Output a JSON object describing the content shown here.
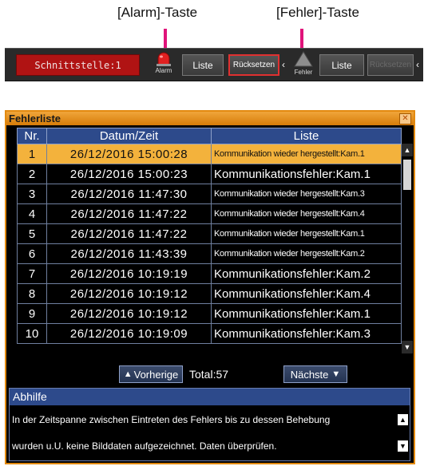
{
  "callouts": {
    "alarm_key": "[Alarm]-Taste",
    "error_key": "[Fehler]-Taste"
  },
  "toolbar": {
    "status_text": "Schnittstelle:1",
    "alarm_label": "Alarm",
    "alarm_list_label": "Liste",
    "alarm_reset_label": "Rücksetzen",
    "error_label": "Fehler",
    "error_list_label": "Liste",
    "error_reset_label": "Rücksetzen"
  },
  "window": {
    "title": "Fehlerliste"
  },
  "table": {
    "headers": [
      "Nr.",
      "Datum/Zeit",
      "Liste"
    ],
    "rows": [
      {
        "nr": "1",
        "datetime": "26/12/2016   15:00:28",
        "entry": "Kommunikation wieder hergestellt:Kam.1",
        "selected": true
      },
      {
        "nr": "2",
        "datetime": "26/12/2016   15:00:23",
        "entry": "Kommunikationsfehler:Kam.1"
      },
      {
        "nr": "3",
        "datetime": "26/12/2016   11:47:30",
        "entry": "Kommunikation wieder hergestellt:Kam.3"
      },
      {
        "nr": "4",
        "datetime": "26/12/2016   11:47:22",
        "entry": "Kommunikation wieder hergestellt:Kam.4"
      },
      {
        "nr": "5",
        "datetime": "26/12/2016   11:47:22",
        "entry": "Kommunikation wieder hergestellt:Kam.1"
      },
      {
        "nr": "6",
        "datetime": "26/12/2016   11:43:39",
        "entry": "Kommunikation wieder hergestellt:Kam.2"
      },
      {
        "nr": "7",
        "datetime": "26/12/2016   10:19:19",
        "entry": "Kommunikationsfehler:Kam.2"
      },
      {
        "nr": "8",
        "datetime": "26/12/2016   10:19:12",
        "entry": "Kommunikationsfehler:Kam.4"
      },
      {
        "nr": "9",
        "datetime": "26/12/2016   10:19:12",
        "entry": "Kommunikationsfehler:Kam.1"
      },
      {
        "nr": "10",
        "datetime": "26/12/2016   10:19:09",
        "entry": "Kommunikationsfehler:Kam.3"
      }
    ]
  },
  "pager": {
    "prev_label": "Vorherige",
    "total_text": "Total:57",
    "next_label": "Nächste"
  },
  "remedy": {
    "title": "Abhilfe",
    "line1": "In der Zeitspanne zwischen Eintreten des Fehlers bis zu dessen Behebung",
    "line2": "wurden u.U. keine Bilddaten aufgezeichnet. Daten überprüfen."
  },
  "colors": {
    "accent": "#e38a10",
    "selected_row": "#f3b23c",
    "header_blue": "#2d4a8b",
    "alarm_status": "#b01313",
    "callout_line": "#e0137a"
  }
}
